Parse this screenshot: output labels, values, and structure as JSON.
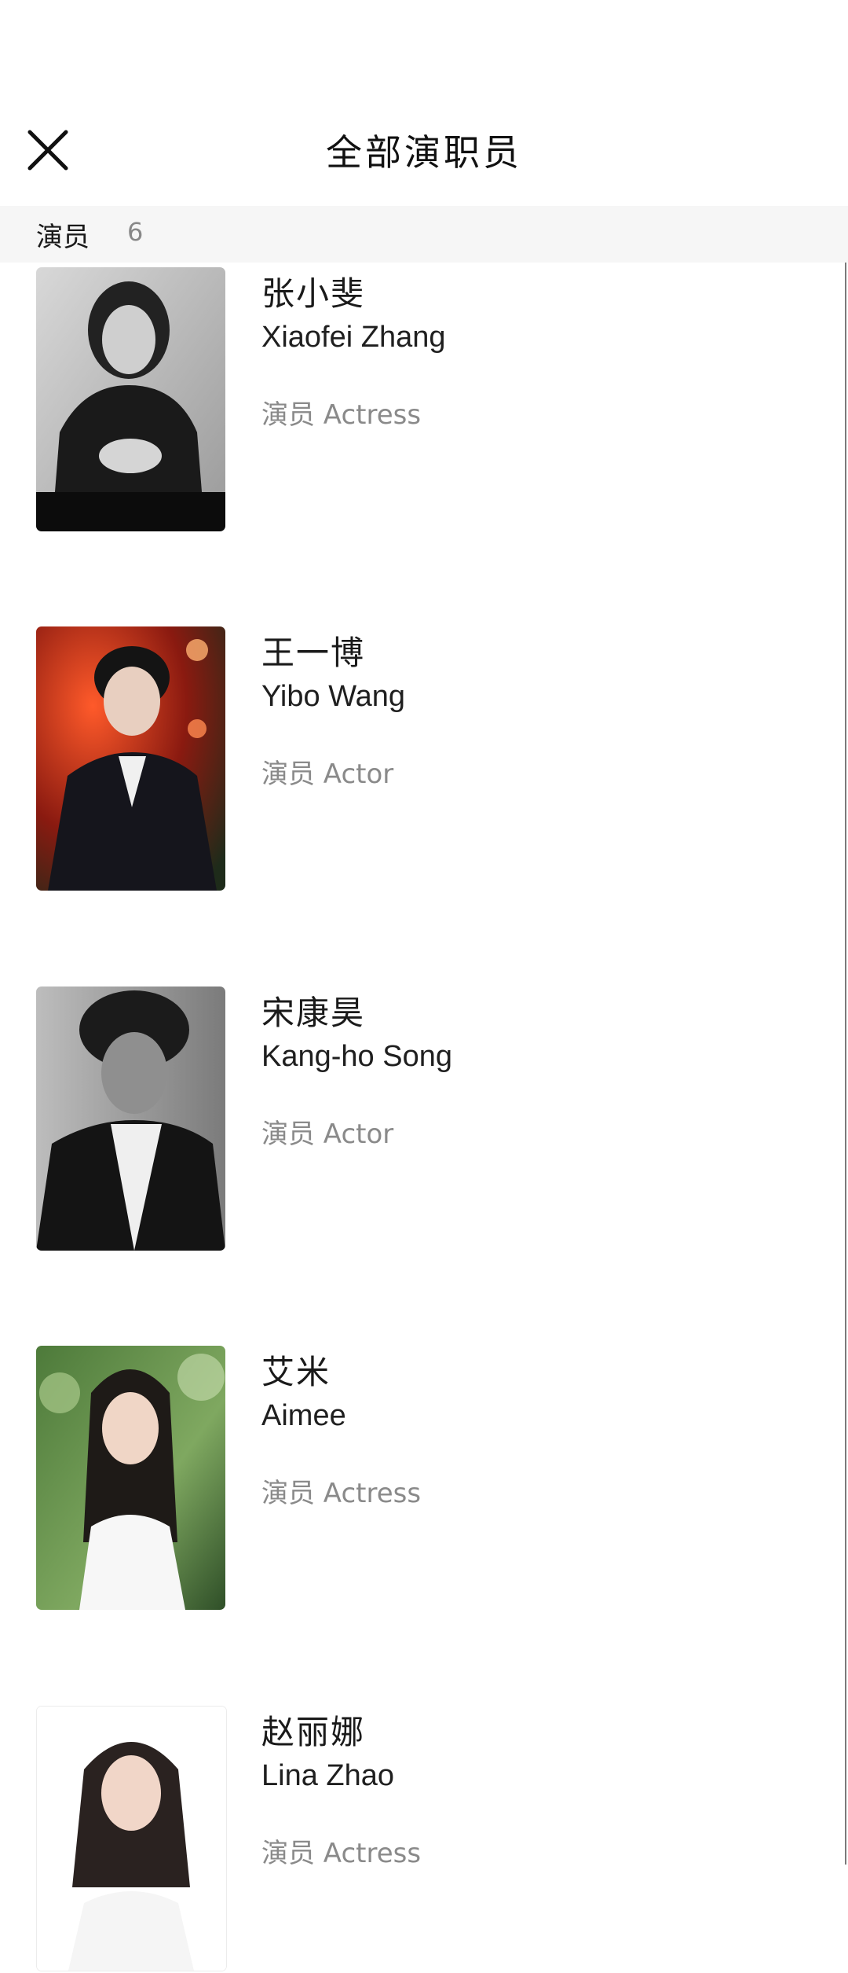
{
  "header": {
    "title": "全部演职员",
    "close_icon": "close-icon"
  },
  "section": {
    "label": "演员",
    "count": "6"
  },
  "cast": [
    {
      "name_cn": "张小斐",
      "name_en": "Xiaofei Zhang",
      "role": "演员 Actress",
      "photo_style": "black-and-white portrait, dark suit"
    },
    {
      "name_cn": "王一博",
      "name_en": "Yibo Wang",
      "role": "演员 Actor",
      "photo_style": "red-toned background, black suit"
    },
    {
      "name_cn": "宋康昊",
      "name_en": "Kang-ho Song",
      "role": "演员 Actor",
      "photo_style": "black-and-white portrait"
    },
    {
      "name_cn": "艾米",
      "name_en": "Aimee",
      "role": "演员 Actress",
      "photo_style": "green foliage background, white top"
    },
    {
      "name_cn": "赵丽娜",
      "name_en": "Lina Zhao",
      "role": "演员 Actress",
      "photo_style": "white background, smiling"
    }
  ]
}
